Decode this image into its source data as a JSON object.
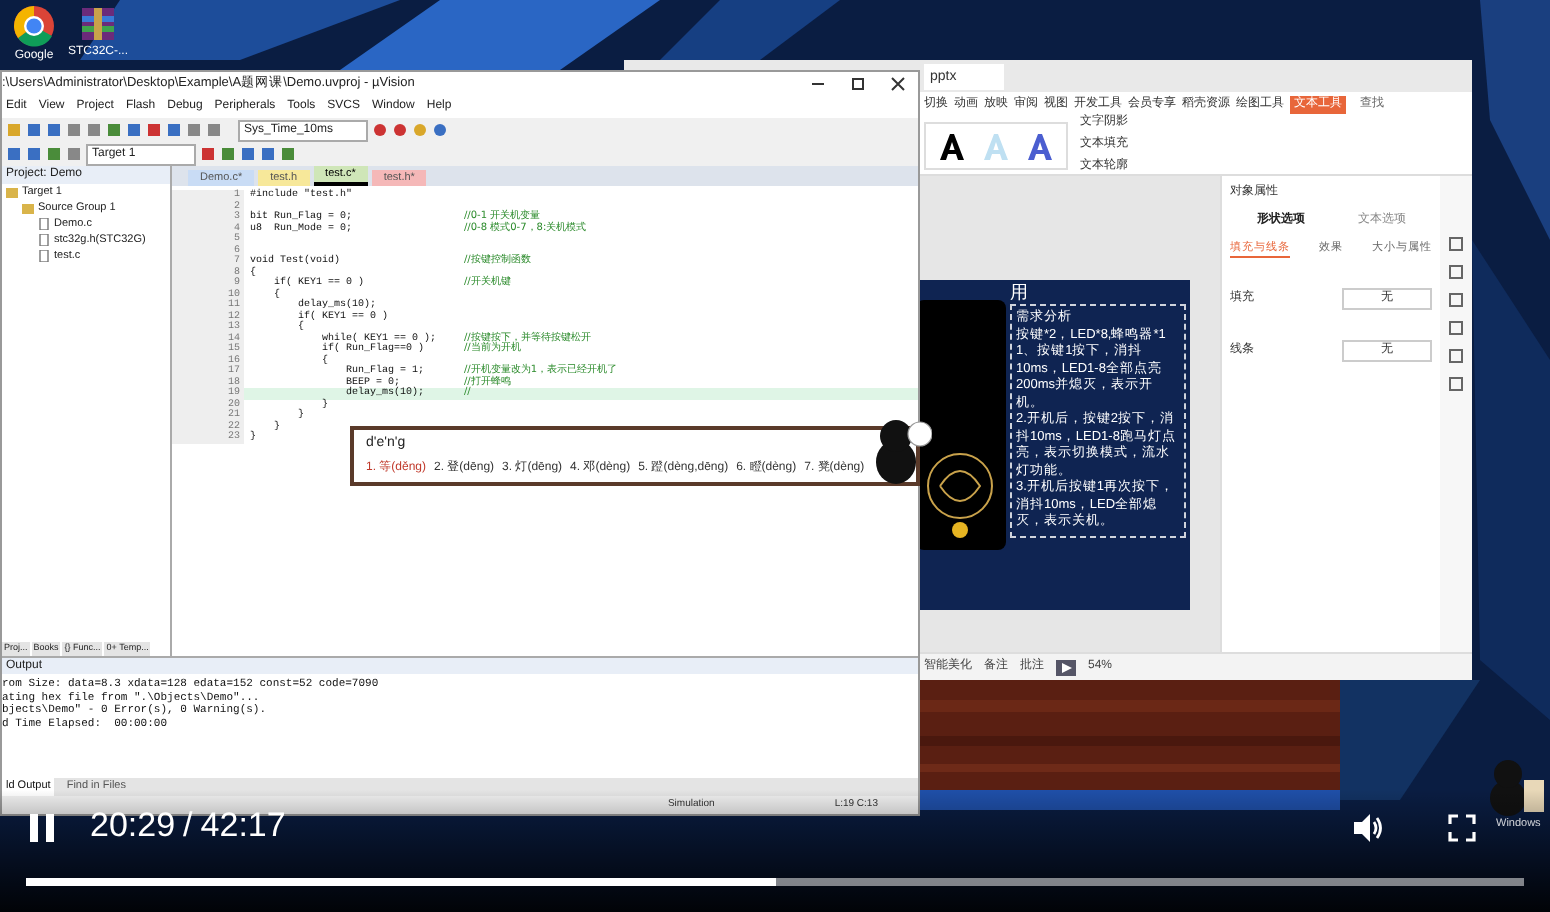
{
  "desktop": {
    "icons": [
      {
        "kind": "browser",
        "label": "Google"
      },
      {
        "kind": "archive",
        "label": "STC32C-..."
      }
    ]
  },
  "keil": {
    "title": ":\\Users\\Administrator\\Desktop\\Example\\A题网课\\Demo.uvproj - µVision",
    "menu": [
      "Edit",
      "View",
      "Project",
      "Flash",
      "Debug",
      "Peripherals",
      "Tools",
      "SVCS",
      "Window",
      "Help"
    ],
    "function_dropdown": "Sys_Time_10ms",
    "target_dropdown": "Target 1",
    "project": {
      "title": "Project: Demo",
      "tree": [
        {
          "label": "Target 1",
          "children": [
            {
              "label": "Source Group 1",
              "children": [
                {
                  "label": "Demo.c"
                },
                {
                  "label": "stc32g.h(STC32G)"
                },
                {
                  "label": "test.c"
                }
              ]
            }
          ]
        }
      ]
    },
    "project_tabs": [
      "Proj...",
      "Books",
      "{} Func...",
      "0+ Temp..."
    ],
    "tabs": [
      {
        "label": "Demo.c*",
        "color": "#c9dcf5",
        "selected": false
      },
      {
        "label": "test.h",
        "color": "#f7e89a",
        "selected": false
      },
      {
        "label": "test.c*",
        "color": "#cfe6b8",
        "selected": true
      },
      {
        "label": "test.h*",
        "color": "#f5b8b8",
        "selected": false
      }
    ],
    "code": [
      {
        "n": "1",
        "text": "#include \"test.h\"",
        "current": false
      },
      {
        "n": "2",
        "current": false
      },
      {
        "n": "3",
        "text": "bit Run_Flag = 0;",
        "comment": "//0-1 开关机变量",
        "current": false
      },
      {
        "n": "4",
        "text": "u8  Run_Mode = 0;",
        "comment": "//0-8 模式0-7，8:关机模式",
        "current": false
      },
      {
        "n": "5",
        "current": false
      },
      {
        "n": "6",
        "current": false
      },
      {
        "n": "7",
        "text": "void Test(void)",
        "comment": "//按键控制函数",
        "current": false
      },
      {
        "n": "8",
        "text": "{",
        "current": false
      },
      {
        "n": "9",
        "text": "    if( KEY1 == 0 )",
        "comment": "//开关机键",
        "current": false
      },
      {
        "n": "10",
        "text": "    {",
        "current": false
      },
      {
        "n": "11",
        "text": "        delay_ms(10);",
        "current": false
      },
      {
        "n": "12",
        "text": "        if( KEY1 == 0 )",
        "current": false
      },
      {
        "n": "13",
        "text": "        {",
        "current": false
      },
      {
        "n": "14",
        "text": "            while( KEY1 == 0 );",
        "comment": "//按键按下，并等待按键松开",
        "current": false
      },
      {
        "n": "15",
        "text": "            if( Run_Flag==0 )",
        "comment": "//当前为开机",
        "current": false
      },
      {
        "n": "16",
        "text": "            {",
        "current": false
      },
      {
        "n": "17",
        "text": "                Run_Flag = 1;",
        "comment": "//开机变量改为1，表示已经开机了",
        "current": false
      },
      {
        "n": "18",
        "text": "                BEEP = 0;",
        "comment": "//打开蜂鸣",
        "current": false
      },
      {
        "n": "19",
        "text": "                delay_ms(10);",
        "comment": "//",
        "current": true
      },
      {
        "n": "20",
        "text": "            }",
        "current": false
      },
      {
        "n": "21",
        "text": "        }",
        "current": false
      },
      {
        "n": "22",
        "text": "    }",
        "current": false
      },
      {
        "n": "23",
        "text": "}",
        "current": false
      }
    ],
    "output": {
      "title": "Output",
      "lines": [
        "rom Size: data=8.3 xdata=128 edata=152 const=52 code=7090",
        "ating hex file from \".\\Objects\\Demo\"...",
        "bjects\\Demo\" - 0 Error(s), 0 Warning(s).",
        "d Time Elapsed:  00:00:00"
      ],
      "tabs": [
        {
          "label": "ld Output",
          "selected": true
        },
        {
          "label": "Find in Files",
          "selected": false
        }
      ]
    },
    "status": [
      "Simulation",
      "L:19 C:13"
    ]
  },
  "ime": {
    "input": "d'e'n'g",
    "candidates": [
      {
        "label": "1. 等(děng)",
        "selected": true
      },
      {
        "label": "2. 登(dēng)",
        "selected": false
      },
      {
        "label": "3. 灯(dēng)",
        "selected": false
      },
      {
        "label": "4. 邓(dèng)",
        "selected": false
      },
      {
        "label": "5. 蹬(dèng,dēng)",
        "selected": false
      },
      {
        "label": "6. 瞪(dèng)",
        "selected": false
      },
      {
        "label": "7. 凳(dèng)",
        "selected": false
      }
    ]
  },
  "wps": {
    "tab": "pptx",
    "menu": [
      {
        "label": "切换",
        "selected": false
      },
      {
        "label": "动画",
        "selected": false
      },
      {
        "label": "放映",
        "selected": false
      },
      {
        "label": "审阅",
        "selected": false
      },
      {
        "label": "视图",
        "selected": false
      },
      {
        "label": "开发工具",
        "selected": false
      },
      {
        "label": "会员专享",
        "selected": false
      },
      {
        "label": "稻壳资源",
        "selected": false
      },
      {
        "label": "绘图工具",
        "selected": false
      },
      {
        "label": "文本工具",
        "selected": true
      }
    ],
    "search": "查找",
    "ribbon": [
      "文字阴影",
      "文本填充",
      "文本轮廓"
    ],
    "panel": {
      "title": "对象属性",
      "tabs": [
        {
          "label": "形状选项",
          "selected": true
        },
        {
          "label": "文本选项",
          "selected": false
        }
      ],
      "subtabs": [
        {
          "label": "填充与线条",
          "selected": true
        },
        {
          "label": "效果",
          "selected": false
        },
        {
          "label": "大小与属性",
          "selected": false
        }
      ],
      "rows": [
        {
          "label": "填充",
          "value": "无"
        },
        {
          "label": "线条",
          "value": "无"
        }
      ]
    },
    "slide": {
      "title": "用",
      "text": [
        "需求分析",
        "按键*2，LED*8,蜂鸣器*1",
        "1、按键1按下，消抖10ms，LED1-8全部点亮200ms并熄灭，表示开机。",
        "2.开机后，按键2按下，消抖10ms，LED1-8跑马灯点亮，表示切换模式，流水灯功能。",
        "3.开机后按键1再次按下，消抖10ms，LED全部熄灭，表示关机。"
      ]
    },
    "status": [
      "智能美化",
      "备注",
      "批注"
    ],
    "zoom": "54%"
  },
  "windows_text": "Windows",
  "video": {
    "playing": true,
    "current": "20:29",
    "separator": "/",
    "total": "42:17",
    "level": 0.5
  }
}
